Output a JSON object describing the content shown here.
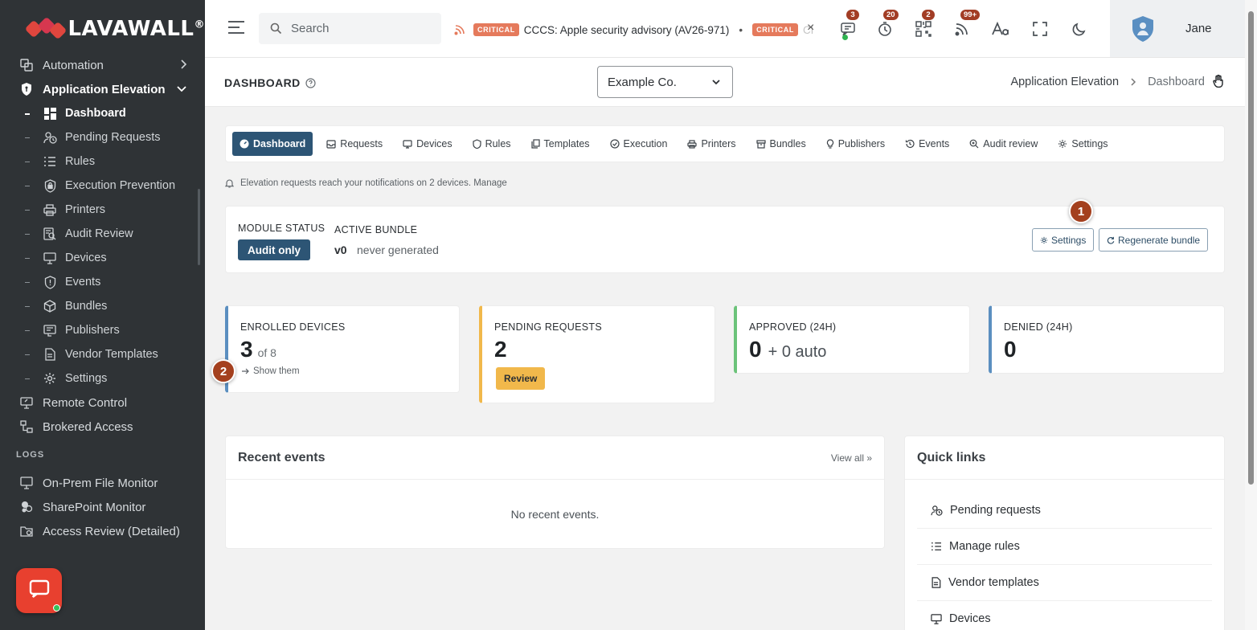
{
  "brand": {
    "name": "LAVAWALL",
    "reg": "®"
  },
  "sidebar": {
    "items_top": [
      {
        "label": "Automation",
        "icon": "automation-icon"
      },
      {
        "label": "Application Elevation",
        "icon": "shield-icon"
      }
    ],
    "subitems": [
      {
        "label": "Dashboard",
        "icon": "dashboard-icon"
      },
      {
        "label": "Pending Requests",
        "icon": "pending-requests-icon"
      },
      {
        "label": "Rules",
        "icon": "rules-icon"
      },
      {
        "label": "Execution Prevention",
        "icon": "lock-shield-icon"
      },
      {
        "label": "Printers",
        "icon": "printer-icon"
      },
      {
        "label": "Audit Review",
        "icon": "audit-icon"
      },
      {
        "label": "Devices",
        "icon": "monitor-icon"
      },
      {
        "label": "Events",
        "icon": "alert-shield-icon"
      },
      {
        "label": "Bundles",
        "icon": "box-icon"
      },
      {
        "label": "Publishers",
        "icon": "publisher-icon"
      },
      {
        "label": "Vendor Templates",
        "icon": "document-icon"
      },
      {
        "label": "Settings",
        "icon": "gear-icon"
      }
    ],
    "items_after": [
      {
        "label": "Remote Control",
        "icon": "remote-icon"
      },
      {
        "label": "Brokered Access",
        "icon": "network-icon"
      }
    ],
    "logs_label": "LOGS",
    "logs_items": [
      {
        "label": "On-Prem File Monitor",
        "icon": "file-monitor-icon"
      },
      {
        "label": "SharePoint Monitor",
        "icon": "sharepoint-icon"
      },
      {
        "label": "Access Review (Detailed)",
        "icon": "folder-clock-icon"
      }
    ]
  },
  "topbar": {
    "search_placeholder": "Search",
    "ticker": {
      "badge1": "CRITICAL",
      "text1": "CCCS: Apple security advisory (AV26-971)",
      "dot": "•",
      "badge2": "CRITICAL",
      "text2": "CI",
      "close": "×"
    },
    "badges": {
      "messages": "3",
      "timer": "20",
      "qr": "2",
      "feeds": "99+"
    },
    "user_name": "Jane"
  },
  "header": {
    "title": "DASHBOARD",
    "org_selected": "Example Co.",
    "breadcrumb": [
      "Application Elevation",
      "Dashboard"
    ]
  },
  "tabs": [
    {
      "label": "Dashboard",
      "icon": "dashboard-gauge-icon",
      "active": true
    },
    {
      "label": "Requests",
      "icon": "inbox-icon"
    },
    {
      "label": "Devices",
      "icon": "monitor-icon"
    },
    {
      "label": "Rules",
      "icon": "shield-outline-icon"
    },
    {
      "label": "Templates",
      "icon": "copy-icon"
    },
    {
      "label": "Execution",
      "icon": "circle-check-icon"
    },
    {
      "label": "Printers",
      "icon": "printer-icon"
    },
    {
      "label": "Bundles",
      "icon": "archive-icon"
    },
    {
      "label": "Publishers",
      "icon": "bulb-icon"
    },
    {
      "label": "Events",
      "icon": "history-icon"
    },
    {
      "label": "Audit review",
      "icon": "search-zoom-icon"
    },
    {
      "label": "Settings",
      "icon": "gear-icon"
    }
  ],
  "notice": "Elevation requests reach your notifications on 2 devices. Manage",
  "module": {
    "status_label": "MODULE STATUS",
    "status_value": "Audit only",
    "bundle_label": "ACTIVE BUNDLE",
    "bundle_version": "v0",
    "bundle_generated": "never generated",
    "settings_button": "Settings",
    "regenerate_button": "Regenerate bundle"
  },
  "markers": {
    "one": "1",
    "two": "2"
  },
  "stats": {
    "enrolled": {
      "label": "ENROLLED DEVICES",
      "value": "3",
      "of": "of 8",
      "link": "Show them"
    },
    "pending": {
      "label": "PENDING REQUESTS",
      "value": "2",
      "button": "Review"
    },
    "approved": {
      "label": "APPROVED (24H)",
      "value": "0",
      "auto": "+ 0 auto"
    },
    "denied": {
      "label": "DENIED (24H)",
      "value": "0"
    }
  },
  "colors": {
    "sidebar_bg": "#2f3336",
    "primary": "#2d5575",
    "stat_blue": "#5b8fc0",
    "stat_yellow": "#f1b84b",
    "stat_green": "#6cc37a",
    "marker": "#a4401e",
    "critical": "#e57a5c",
    "chat": "#e8402f"
  },
  "recent_events": {
    "title": "Recent events",
    "view_all": "View all »",
    "empty": "No recent events."
  },
  "quick_links": {
    "title": "Quick links",
    "items": [
      {
        "label": "Pending requests",
        "icon": "pending-requests-icon"
      },
      {
        "label": "Manage rules",
        "icon": "rules-icon"
      },
      {
        "label": "Vendor templates",
        "icon": "document-icon"
      },
      {
        "label": "Devices",
        "icon": "monitor-icon"
      }
    ]
  }
}
